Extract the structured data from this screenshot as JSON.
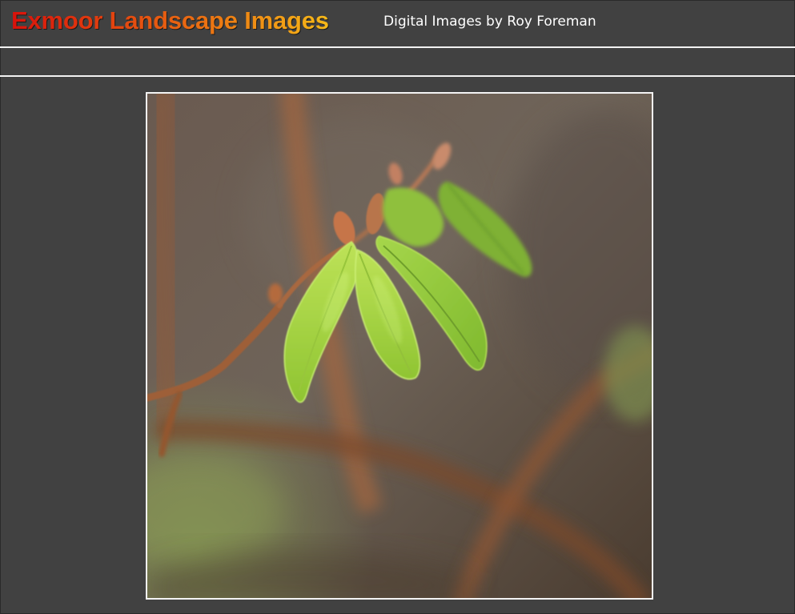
{
  "header": {
    "title": "Exmoor Landscape Images",
    "subtitle": "Digital Images by Roy Foreman"
  },
  "photo": {
    "subject": "leaf-buds-on-twig"
  },
  "colors": {
    "page_background": "#414141",
    "rule": "#f2f2f2",
    "title_gradient_start": "#d8120b",
    "title_gradient_end": "#f6b918",
    "subtitle": "#ffffff",
    "photo_border": "#f4f4f4"
  }
}
